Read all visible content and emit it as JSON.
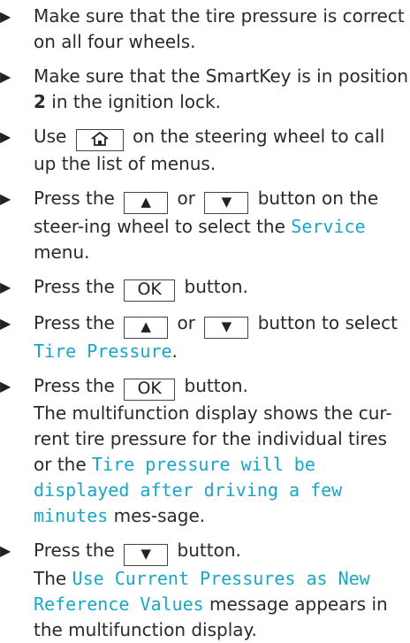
{
  "steps": [
    {
      "text": "Make sure that the tire pressure is correct on all four wheels."
    },
    {
      "before": "Make sure that the SmartKey is in position ",
      "bold": "2",
      "after": " in the ignition lock."
    },
    {
      "before": "Use ",
      "key_icon": "home-icon",
      "after": " on the steering wheel to call up the list of menus."
    },
    {
      "before": "Press the ",
      "key_up": "▲",
      "mid": " or ",
      "key_down": "▼",
      "after1": " button on the steer-ing wheel to select the ",
      "display": "Service",
      "after2": " menu."
    },
    {
      "before": "Press the ",
      "key": "OK",
      "after": " button."
    },
    {
      "before": "Press the ",
      "key_up": "▲",
      "mid": " or ",
      "key_down": "▼",
      "after1": " button to select ",
      "display": "Tire Pressure",
      "after2": "."
    },
    {
      "before": "Press the ",
      "key": "OK",
      "after": " button.",
      "note_before": "The multifunction display shows the cur-rent tire pressure for the individual tires or the ",
      "note_display": "Tire pressure will be displayed after driving a few minutes",
      "note_after": " mes-sage."
    },
    {
      "before": "Press the ",
      "key_down": "▼",
      "after": " button.",
      "note_before": "The ",
      "note_display": "Use Current Pressures as New Reference Values",
      "note_after": " message appears in the multifunction display."
    }
  ],
  "colors": {
    "display_text": "#17a7c6",
    "body_text": "#2a2a2a"
  },
  "bullet": "▶"
}
